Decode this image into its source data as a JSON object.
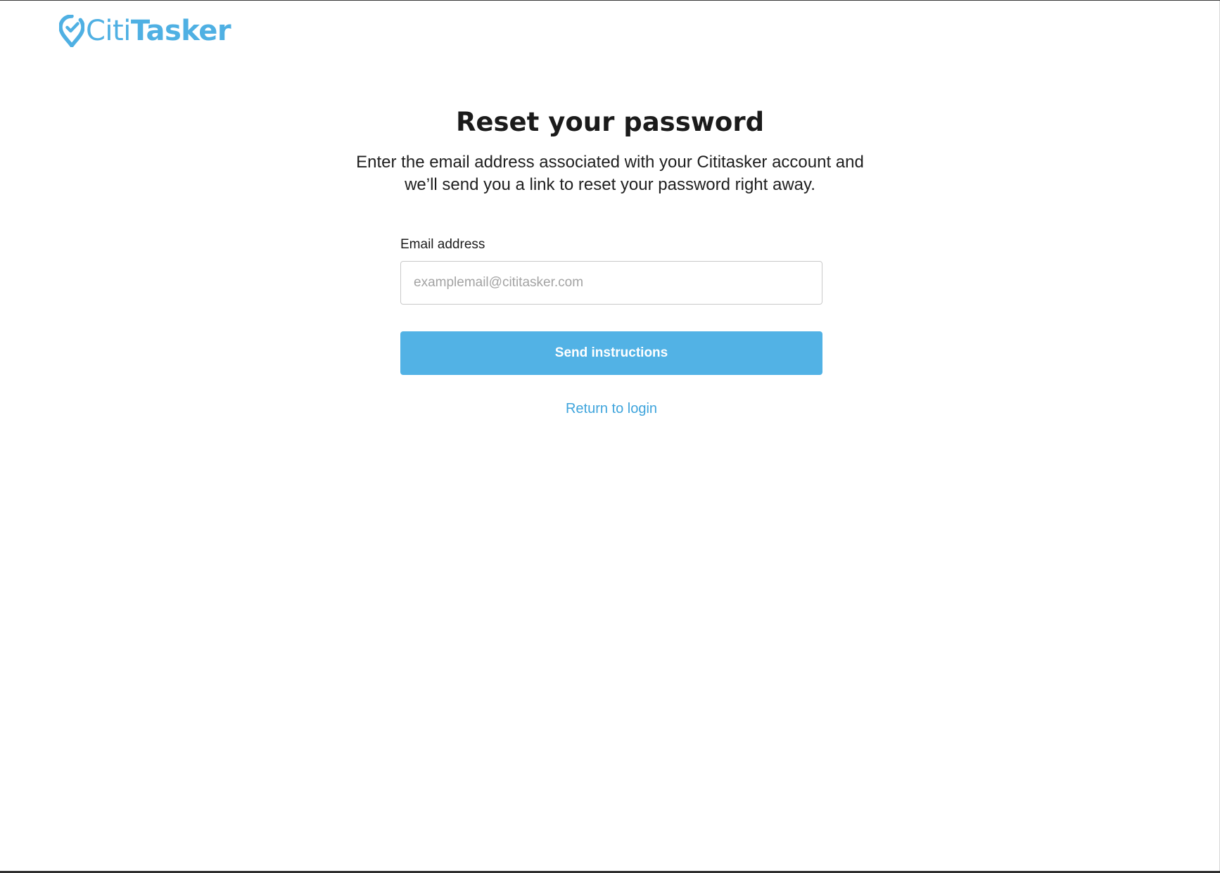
{
  "header": {
    "logo_icon": "location-pin-check-icon",
    "logo_part_1": "Citi",
    "logo_part_2": "Tasker"
  },
  "main": {
    "title": "Reset your password",
    "subtitle": "Enter the email address associated with your Cititasker account and we’ll send you a link to reset your password right away."
  },
  "form": {
    "email_label": "Email address",
    "email_value": "",
    "email_placeholder": "examplemail@cititasker.com",
    "submit_label": "Send instructions",
    "return_link": "Return to login"
  },
  "colors": {
    "brand": "#4fb0e3",
    "button": "#52b2e5",
    "link": "#3ea4dc"
  }
}
